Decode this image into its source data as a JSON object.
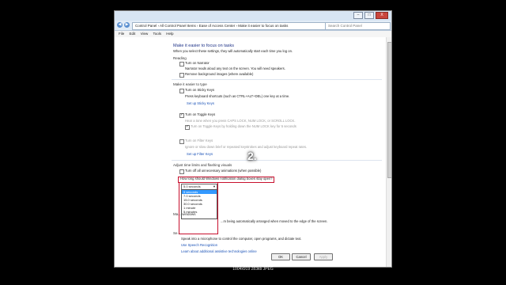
{
  "window": {
    "address": "Control Panel › All Control Panel Items › Ease of Access Center › Make it easier to focus on tasks",
    "search_placeholder": "Search Control Panel",
    "controls": [
      "–",
      "□",
      "X"
    ]
  },
  "menu": [
    "File",
    "Edit",
    "View",
    "Tools",
    "Help"
  ],
  "page": {
    "title": "Make it easier to focus on tasks",
    "subtitle": "When you select these settings, they will automatically start each time you log on.",
    "reading": {
      "heading": "Reading",
      "narrator_label": "Turn on Narrator",
      "narrator_desc": "Narrator reads aloud any text on the screen. You will need speakers.",
      "bg_images_label": "Remove background images (where available)"
    },
    "typing": {
      "heading": "Make it easier to type",
      "sticky_label": "Turn on Sticky Keys",
      "sticky_desc": "Press keyboard shortcuts (such as CTRL+ALT+DEL) one key at a time.",
      "sticky_link": "Set up Sticky Keys",
      "toggle_label": "Turn on Toggle Keys",
      "toggle_desc": "Hear a tone when you press CAPS LOCK, NUM LOCK, or SCROLL LOCK.",
      "toggle_sub": "Turn on Toggle Keys by holding down the NUM LOCK key for 5 seconds",
      "filter_label": "Turn on Filter Keys",
      "filter_desc": "Ignore or slow down brief or repeated keystrokes and adjust keyboard repeat rates.",
      "filter_link": "Set up Filter Keys"
    },
    "timing": {
      "heading": "Adjust time limits and flashing visuals",
      "animations_label": "Turn off all unnecessary animations (when possible)",
      "question": "How long should Windows notification dialog boxes stay open?",
      "selected": "5.0 seconds",
      "options": [
        "5 seconds",
        "7.0 seconds",
        "15.0 seconds",
        "30.0 seconds",
        "1 minute",
        "5 minutes"
      ],
      "selected_index": 0
    },
    "windows_heading": "Ma... windows",
    "windows_desc": "...m being automatically arranged when moved to the edge of the screen.",
    "speech": {
      "heading": "Se...",
      "desc": "Speak into a microphone to control the computer, open programs, and dictate text.",
      "link1": "Use Speech Recognition",
      "link2": "Learn about additional assistive technologies online"
    }
  },
  "buttons": {
    "ok": "OK",
    "cancel": "Cancel",
    "apply": "Apply"
  },
  "overlay_number": "2.",
  "caption": "1004x919 283kb JPEG"
}
